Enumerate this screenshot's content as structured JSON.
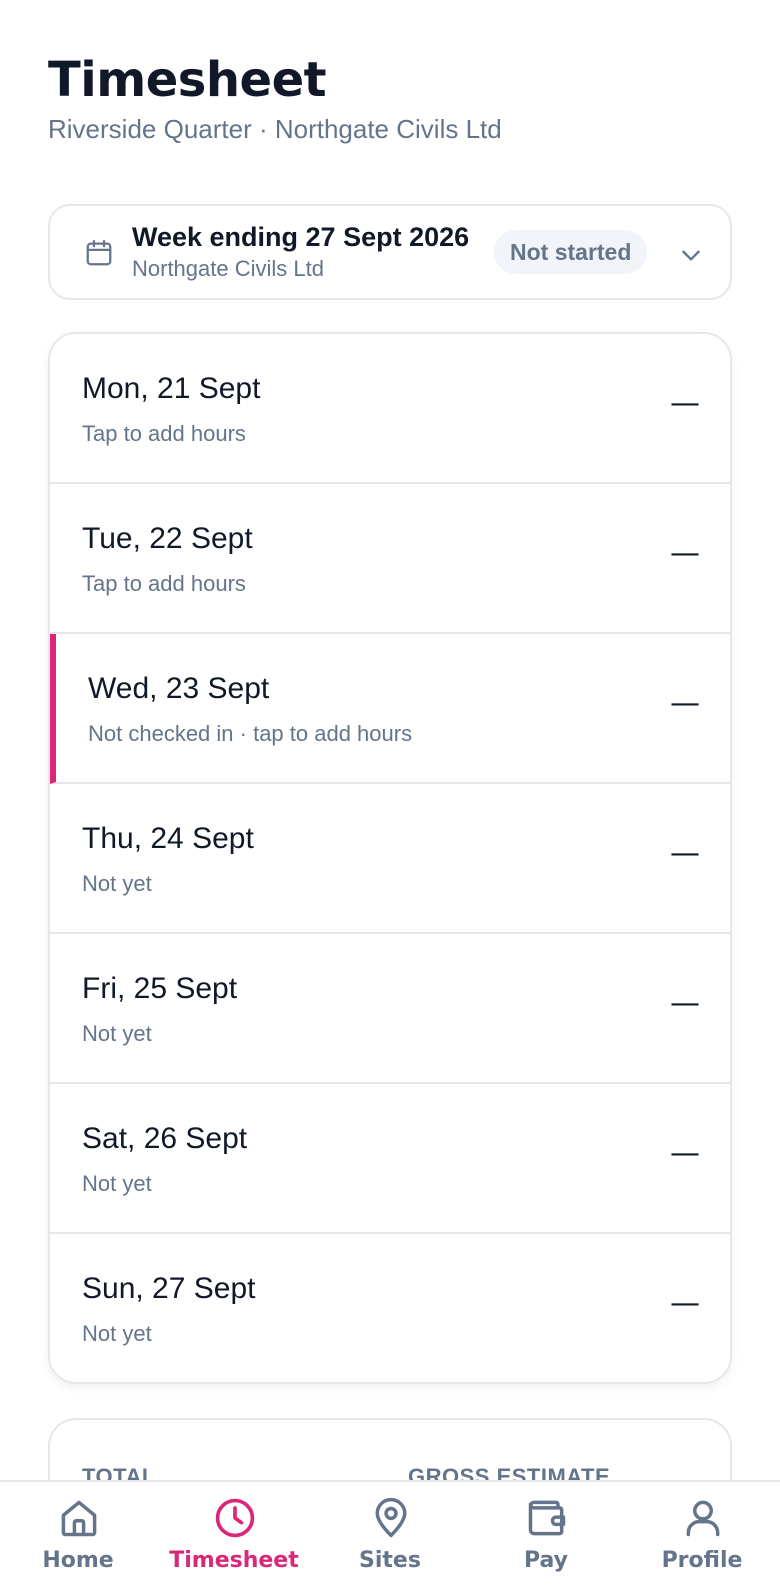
{
  "header": {
    "title": "Timesheet",
    "subtitle": "Riverside Quarter · Northgate Civils Ltd"
  },
  "week": {
    "title": "Week ending 27 Sept 2026",
    "employer": "Northgate Civils Ltd",
    "status": "Not started"
  },
  "days": [
    {
      "label": "Mon, 21 Sept",
      "hint": "Tap to add hours",
      "value": "—"
    },
    {
      "label": "Tue, 22 Sept",
      "hint": "Tap to add hours",
      "value": "—"
    },
    {
      "label": "Wed, 23 Sept",
      "hint": "Not checked in · tap to add hours",
      "value": "—"
    },
    {
      "label": "Thu, 24 Sept",
      "hint": "Not yet",
      "value": "—"
    },
    {
      "label": "Fri, 25 Sept",
      "hint": "Not yet",
      "value": "—"
    },
    {
      "label": "Sat, 26 Sept",
      "hint": "Not yet",
      "value": "—"
    },
    {
      "label": "Sun, 27 Sept",
      "hint": "Not yet",
      "value": "—"
    }
  ],
  "totals": {
    "total_label": "TOTAL",
    "gross_label": "GROSS ESTIMATE"
  },
  "nav": [
    {
      "label": "Home",
      "icon": "home-icon"
    },
    {
      "label": "Timesheet",
      "icon": "clock-icon",
      "active": true
    },
    {
      "label": "Sites",
      "icon": "map-pin-icon"
    },
    {
      "label": "Pay",
      "icon": "wallet-icon"
    },
    {
      "label": "Profile",
      "icon": "user-icon"
    }
  ],
  "colors": {
    "accent": "#db2777",
    "text": "#111827",
    "muted": "#64748b",
    "border": "#e5e7eb"
  }
}
